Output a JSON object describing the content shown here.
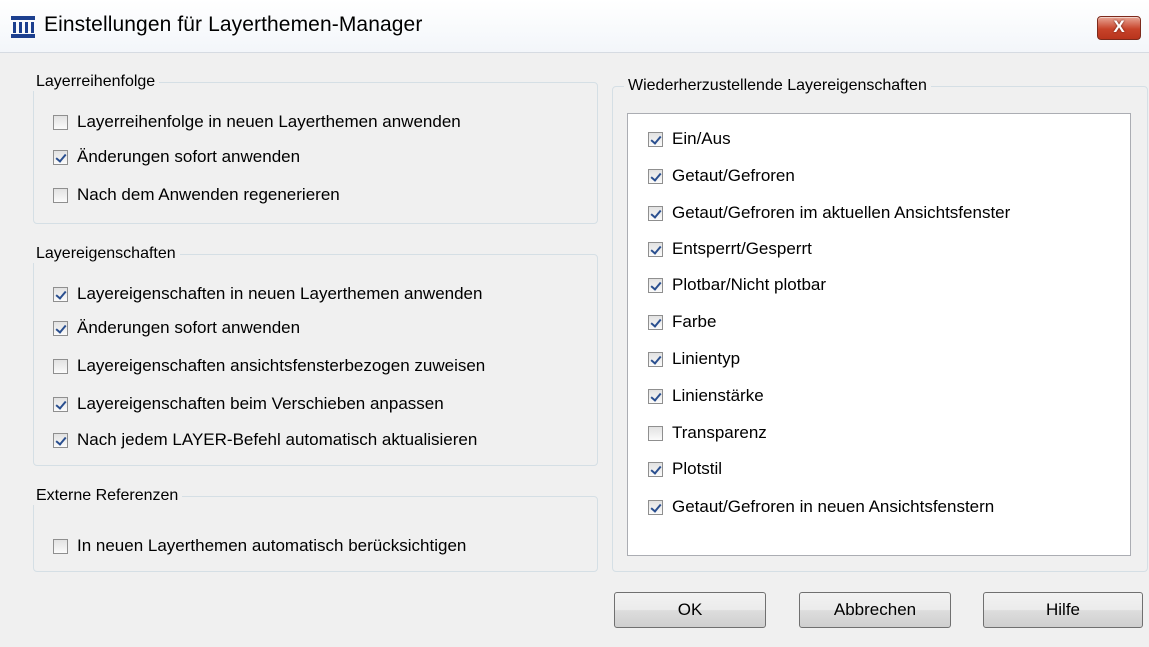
{
  "window": {
    "title": "Einstellungen für Layerthemen-Manager",
    "close_label": "X",
    "icon": "layer-states-icon"
  },
  "groups": {
    "layer_order": {
      "title": "Layerreihenfolge",
      "items": [
        {
          "label": "Layerreihenfolge in neuen Layerthemen anwenden",
          "checked": false
        },
        {
          "label": "Änderungen sofort anwenden",
          "checked": true
        },
        {
          "label": "Nach dem Anwenden regenerieren",
          "checked": false
        }
      ]
    },
    "layer_props": {
      "title": "Layereigenschaften",
      "items": [
        {
          "label": "Layereigenschaften in neuen Layerthemen anwenden",
          "checked": true
        },
        {
          "label": "Änderungen sofort anwenden",
          "checked": true
        },
        {
          "label": "Layereigenschaften ansichtsfensterbezogen zuweisen",
          "checked": false
        },
        {
          "label": "Layereigenschaften beim Verschieben anpassen",
          "checked": true
        },
        {
          "label": "Nach jedem LAYER-Befehl automatisch aktualisieren",
          "checked": true
        }
      ]
    },
    "xrefs": {
      "title": "Externe Referenzen",
      "items": [
        {
          "label": "In neuen Layerthemen automatisch berücksichtigen",
          "checked": false
        }
      ]
    },
    "restore": {
      "title": "Wiederherzustellende Layereigenschaften",
      "items": [
        {
          "label": "Ein/Aus",
          "checked": true
        },
        {
          "label": "Getaut/Gefroren",
          "checked": true
        },
        {
          "label": "Getaut/Gefroren im aktuellen Ansichtsfenster",
          "checked": true
        },
        {
          "label": "Entsperrt/Gesperrt",
          "checked": true
        },
        {
          "label": "Plotbar/Nicht plotbar",
          "checked": true
        },
        {
          "label": "Farbe",
          "checked": true
        },
        {
          "label": "Linientyp",
          "checked": true
        },
        {
          "label": "Linienstärke",
          "checked": true
        },
        {
          "label": "Transparenz",
          "checked": false
        },
        {
          "label": "Plotstil",
          "checked": true
        },
        {
          "label": "Getaut/Gefroren in neuen Ansichtsfenstern",
          "checked": true
        }
      ]
    }
  },
  "buttons": {
    "ok": "OK",
    "cancel": "Abbrechen",
    "help": "Hilfe"
  },
  "colors": {
    "check_mark": "#2a4f8f",
    "close_button": "#c7432a",
    "dialog_bg": "#f0f0f0"
  }
}
